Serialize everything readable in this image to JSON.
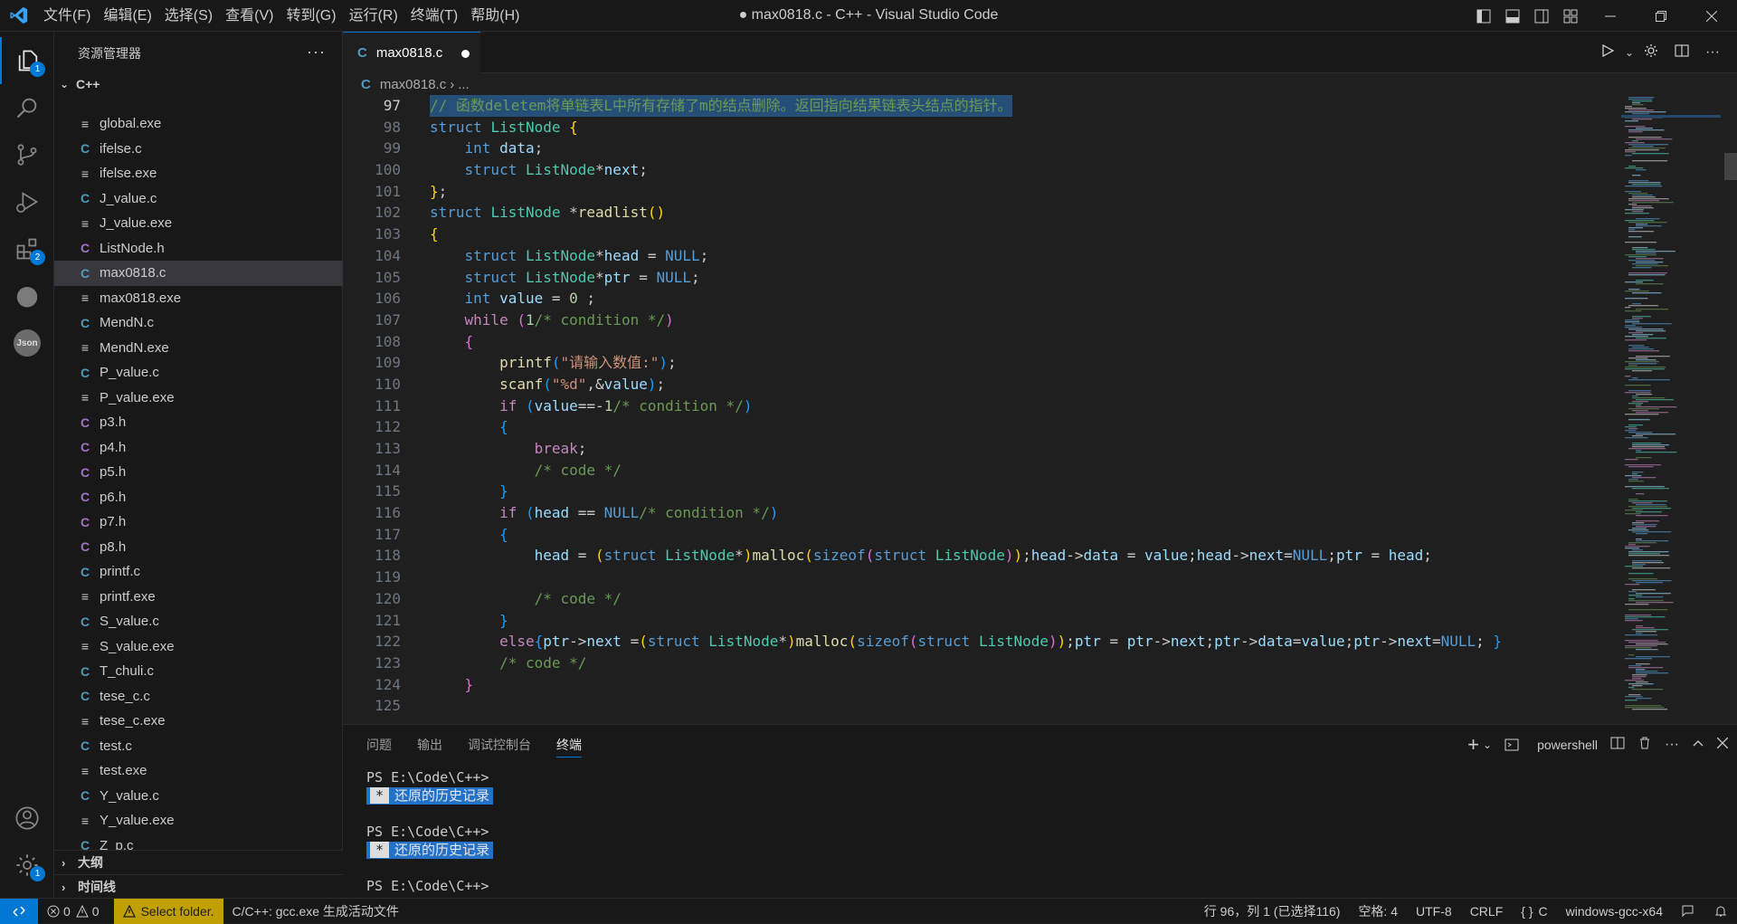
{
  "titlebar": {
    "menu": [
      "文件(F)",
      "编辑(E)",
      "选择(S)",
      "查看(V)",
      "转到(G)",
      "运行(R)",
      "终端(T)",
      "帮助(H)"
    ],
    "window_title": "● max0818.c - C++ - Visual Studio Code"
  },
  "activity": {
    "explorer_badge": "1",
    "extensions_badge": "2",
    "settings_badge": "1",
    "json_label": "Json"
  },
  "sidebar": {
    "title": "资源管理器",
    "more": "···",
    "folder": "C++",
    "files": [
      {
        "name": "global.exe",
        "type": "exe"
      },
      {
        "name": "ifelse.c",
        "type": "c"
      },
      {
        "name": "ifelse.exe",
        "type": "exe"
      },
      {
        "name": "J_value.c",
        "type": "c"
      },
      {
        "name": "J_value.exe",
        "type": "exe"
      },
      {
        "name": "ListNode.h",
        "type": "h"
      },
      {
        "name": "max0818.c",
        "type": "c"
      },
      {
        "name": "max0818.exe",
        "type": "exe"
      },
      {
        "name": "MendN.c",
        "type": "c"
      },
      {
        "name": "MendN.exe",
        "type": "exe"
      },
      {
        "name": "P_value.c",
        "type": "c"
      },
      {
        "name": "P_value.exe",
        "type": "exe"
      },
      {
        "name": "p3.h",
        "type": "h"
      },
      {
        "name": "p4.h",
        "type": "h"
      },
      {
        "name": "p5.h",
        "type": "h"
      },
      {
        "name": "p6.h",
        "type": "h"
      },
      {
        "name": "p7.h",
        "type": "h"
      },
      {
        "name": "p8.h",
        "type": "h"
      },
      {
        "name": "printf.c",
        "type": "c"
      },
      {
        "name": "printf.exe",
        "type": "exe"
      },
      {
        "name": "S_value.c",
        "type": "c"
      },
      {
        "name": "S_value.exe",
        "type": "exe"
      },
      {
        "name": "T_chuli.c",
        "type": "c"
      },
      {
        "name": "tese_c.c",
        "type": "c"
      },
      {
        "name": "tese_c.exe",
        "type": "exe"
      },
      {
        "name": "test.c",
        "type": "c"
      },
      {
        "name": "test.exe",
        "type": "exe"
      },
      {
        "name": "Y_value.c",
        "type": "c"
      },
      {
        "name": "Y_value.exe",
        "type": "exe"
      },
      {
        "name": "Z_p.c",
        "type": "c"
      }
    ],
    "selected": "max0818.c",
    "outline": "大纲",
    "timeline": "时间线"
  },
  "editor": {
    "tab_label": "max0818.c",
    "breadcrumb_file": "max0818.c",
    "breadcrumb_more": "...",
    "line_numbers": [
      "97",
      "98",
      "99",
      "100",
      "101",
      "102",
      "103",
      "104",
      "105",
      "106",
      "107",
      "108",
      "109",
      "110",
      "111",
      "112",
      "113",
      "114",
      "115",
      "116",
      "117",
      "118",
      "119",
      "120",
      "121",
      "122",
      "123",
      "124",
      "125"
    ],
    "comment_line": "// 函数deletem将单链表L中所有存储了m的结点删除。返回指向结果链表头结点的指针。",
    "str_prompt": "\"请输入数值:\"",
    "str_fmt": "\"%d\""
  },
  "panel": {
    "tabs": [
      "问题",
      "输出",
      "调试控制台",
      "终端"
    ],
    "active_tab": "终端",
    "shell": "powershell",
    "prompt": "PS E:\\Code\\C++>",
    "restore_text": "还原的历史记录"
  },
  "statusbar": {
    "errors": "0",
    "warnings": "0",
    "warn_label": "Select folder.",
    "config": "C/C++: gcc.exe 生成活动文件",
    "position": "行 96，列 1 (已选择116)",
    "spaces": "空格: 4",
    "encoding": "UTF-8",
    "eol": "CRLF",
    "language": "C",
    "platform": "windows-gcc-x64"
  },
  "colors": {
    "accent": "#0078d4",
    "warning_bg": "#c0a000"
  }
}
